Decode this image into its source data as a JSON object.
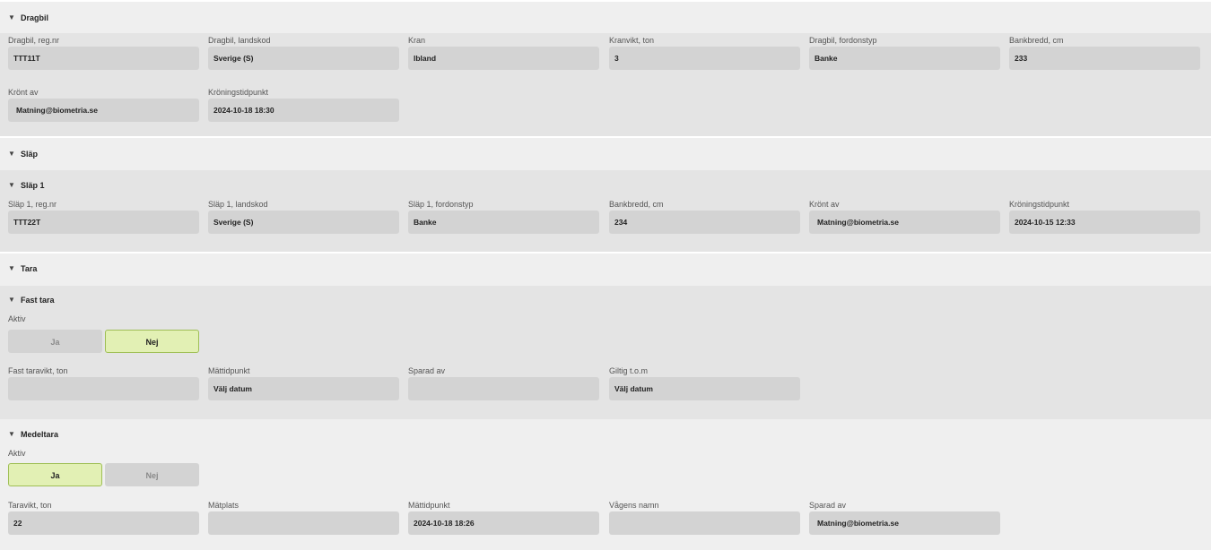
{
  "dragbil": {
    "title": "Dragbil",
    "fields": [
      {
        "label": "Dragbil, reg.nr",
        "value": "TTT11T"
      },
      {
        "label": "Dragbil, landskod",
        "value": "Sverige (S)"
      },
      {
        "label": "Kran",
        "value": "Ibland"
      },
      {
        "label": "Kranvikt, ton",
        "value": "3"
      },
      {
        "label": "Dragbil, fordonstyp",
        "value": "Banke"
      },
      {
        "label": "Bankbredd, cm",
        "value": "233"
      },
      {
        "label": "Krönt av",
        "value": "Matning@biometria.se"
      },
      {
        "label": "Kröningstidpunkt",
        "value": "2024-10-18 18:30"
      }
    ]
  },
  "slap": {
    "title": "Släp",
    "slap1": {
      "title": "Släp 1",
      "fields": [
        {
          "label": "Släp 1, reg.nr",
          "value": "TTT22T"
        },
        {
          "label": "Släp 1, landskod",
          "value": "Sverige (S)"
        },
        {
          "label": "Släp 1, fordonstyp",
          "value": "Banke"
        },
        {
          "label": "Bankbredd, cm",
          "value": "234"
        },
        {
          "label": "Krönt av",
          "value": "Matning@biometria.se"
        },
        {
          "label": "Kröningstidpunkt",
          "value": "2024-10-15 12:33"
        }
      ]
    }
  },
  "tara": {
    "title": "Tara",
    "fast_tara": {
      "title": "Fast tara",
      "aktiv_label": "Aktiv",
      "toggle": {
        "yes": "Ja",
        "no": "Nej",
        "selected": "Nej"
      },
      "fields": [
        {
          "label": "Fast taravikt, ton",
          "value": ""
        },
        {
          "label": "Mättidpunkt",
          "value": "Välj datum"
        },
        {
          "label": "Sparad av",
          "value": ""
        },
        {
          "label": "Giltig t.o.m",
          "value": "Välj datum"
        }
      ]
    },
    "medeltara": {
      "title": "Medeltara",
      "aktiv_label": "Aktiv",
      "toggle": {
        "yes": "Ja",
        "no": "Nej",
        "selected": "Ja"
      },
      "fields": [
        {
          "label": "Taravikt, ton",
          "value": "22"
        },
        {
          "label": "Mätplats",
          "value": ""
        },
        {
          "label": "Mättidpunkt",
          "value": "2024-10-18 18:26"
        },
        {
          "label": "Vågens namn",
          "value": ""
        },
        {
          "label": "Sparad av",
          "value": "Matning@biometria.se"
        }
      ]
    }
  }
}
